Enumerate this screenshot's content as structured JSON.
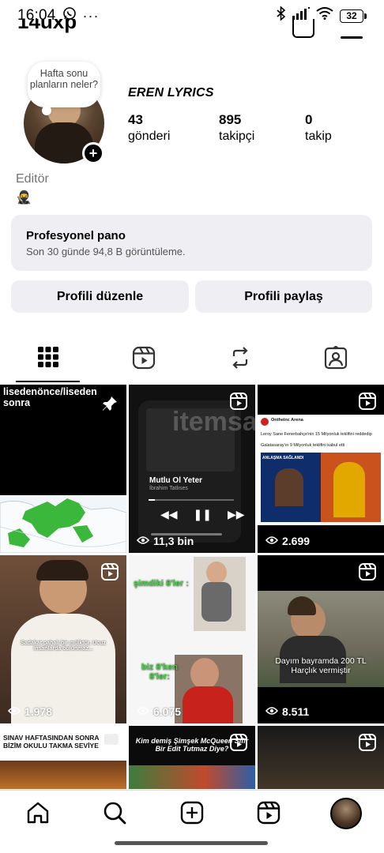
{
  "status_bar": {
    "time": "16:04",
    "battery": "32"
  },
  "header": {
    "username": "14uxp"
  },
  "profile": {
    "note": "Hafta sonu planların neler?",
    "display_name": "EREN LYRICS",
    "stats": [
      {
        "value": "43",
        "label": "gönderi"
      },
      {
        "value": "895",
        "label": "takipçi"
      },
      {
        "value": "0",
        "label": "takip"
      }
    ],
    "category": "Editör",
    "bio_emoji": "🥷"
  },
  "pro_dashboard": {
    "title": "Profesyonel pano",
    "subtitle": "Son 30 günde 94,8 B görüntüleme."
  },
  "buttons": {
    "edit": "Profili düzenle",
    "share": "Profili paylaş"
  },
  "tabs": [
    "grid-icon",
    "reels-icon",
    "reposts-icon",
    "tagged-icon"
  ],
  "posts": [
    {
      "caption": "lisedenönce/liseden sonra",
      "views": ""
    },
    {
      "song": "Mutlu Ol Yeter",
      "artist": "İbrahim Tatlıses",
      "watermark": "itemsa",
      "views": "11,3 bin"
    },
    {
      "source": "Ontheinc Arena",
      "headline1": "Leroy Sane Fenerbahçe'nin 15 Milyonluk teklifini reddedip",
      "headline2": "Galatasaray'ın 9 Milyonluk teklifini kabul etti",
      "badge": "ANLAŞMA SAĞLANDI",
      "views": "2.699"
    },
    {
      "caption": "Sadakat pahalı bir mülktür, Ucuz insanlarda bulunmaz...",
      "views": "1.978"
    },
    {
      "caption_top": "şimdiki 8'ler :",
      "caption_bottom": "biz 8'ken 8'ler:",
      "views": "6.075"
    },
    {
      "caption": "Dayım bayramda 200 TL Harçlık vermiştir",
      "views": "8.511"
    },
    {
      "caption": "SINAV HAFTASINDAN SONRA BİZİM OKULU TAKMA SEVİYE"
    },
    {
      "caption": "Kim demiş Şimşek McQueen Sıfır Bir Edit Tutmaz Diye?"
    },
    {
      "caption": ""
    }
  ],
  "colors": {
    "panel_bg": "#efeff3",
    "map_green": "#3bb83b",
    "secondary_text": "#737373"
  }
}
